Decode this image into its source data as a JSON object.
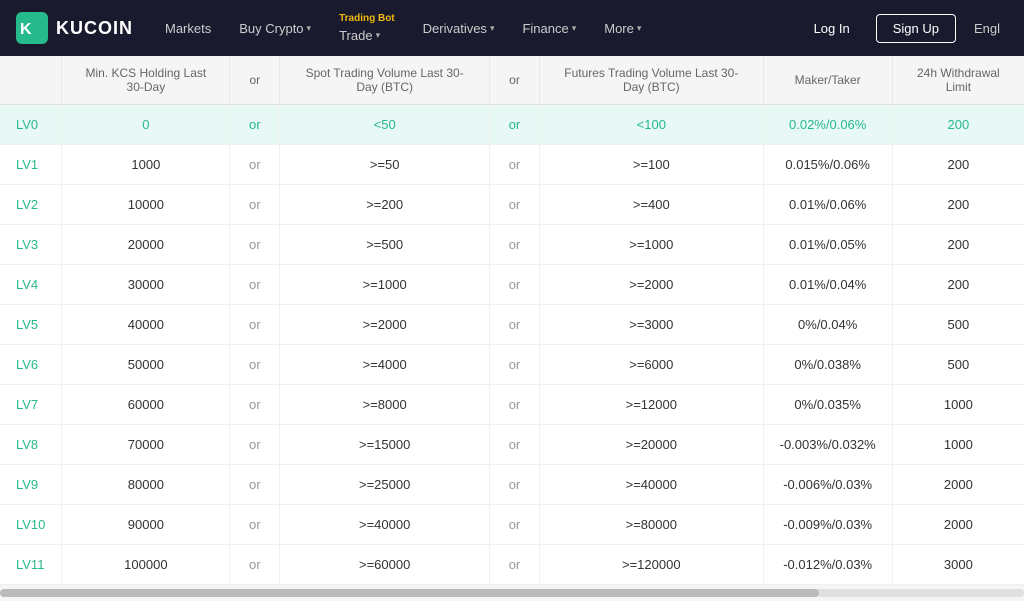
{
  "navbar": {
    "logo_text": "KUCOIN",
    "markets_label": "Markets",
    "buy_crypto_label": "Buy Crypto",
    "trading_bot_sublabel": "Trading Bot",
    "trade_label": "Trade",
    "derivatives_label": "Derivatives",
    "finance_label": "Finance",
    "more_label": "More",
    "login_label": "Log In",
    "signup_label": "Sign Up",
    "lang_label": "Engl"
  },
  "table": {
    "headers": [
      "Min. KCS Holding Last 30-Day",
      "or",
      "Spot Trading Volume Last 30-Day (BTC)",
      "or",
      "Futures Trading Volume Last 30-Day (BTC)",
      "Maker/Taker",
      "24h Withdrawal Limit"
    ],
    "rows": [
      {
        "level": "LV0",
        "kcs": "0",
        "or1": "or",
        "spot": "<50",
        "or2": "or",
        "futures": "<100",
        "fee": "0.02%/0.06%",
        "limit": "200",
        "highlight": true
      },
      {
        "level": "LV1",
        "kcs": "1000",
        "or1": "or",
        "spot": ">=50",
        "or2": "or",
        "futures": ">=100",
        "fee": "0.015%/0.06%",
        "limit": "200",
        "highlight": false
      },
      {
        "level": "LV2",
        "kcs": "10000",
        "or1": "or",
        "spot": ">=200",
        "or2": "or",
        "futures": ">=400",
        "fee": "0.01%/0.06%",
        "limit": "200",
        "highlight": false
      },
      {
        "level": "LV3",
        "kcs": "20000",
        "or1": "or",
        "spot": ">=500",
        "or2": "or",
        "futures": ">=1000",
        "fee": "0.01%/0.05%",
        "limit": "200",
        "highlight": false
      },
      {
        "level": "LV4",
        "kcs": "30000",
        "or1": "or",
        "spot": ">=1000",
        "or2": "or",
        "futures": ">=2000",
        "fee": "0.01%/0.04%",
        "limit": "200",
        "highlight": false
      },
      {
        "level": "LV5",
        "kcs": "40000",
        "or1": "or",
        "spot": ">=2000",
        "or2": "or",
        "futures": ">=3000",
        "fee": "0%/0.04%",
        "limit": "500",
        "highlight": false
      },
      {
        "level": "LV6",
        "kcs": "50000",
        "or1": "or",
        "spot": ">=4000",
        "or2": "or",
        "futures": ">=6000",
        "fee": "0%/0.038%",
        "limit": "500",
        "highlight": false
      },
      {
        "level": "LV7",
        "kcs": "60000",
        "or1": "or",
        "spot": ">=8000",
        "or2": "or",
        "futures": ">=12000",
        "fee": "0%/0.035%",
        "limit": "1000",
        "highlight": false
      },
      {
        "level": "LV8",
        "kcs": "70000",
        "or1": "or",
        "spot": ">=15000",
        "or2": "or",
        "futures": ">=20000",
        "fee": "-0.003%/0.032%",
        "limit": "1000",
        "highlight": false
      },
      {
        "level": "LV9",
        "kcs": "80000",
        "or1": "or",
        "spot": ">=25000",
        "or2": "or",
        "futures": ">=40000",
        "fee": "-0.006%/0.03%",
        "limit": "2000",
        "highlight": false
      },
      {
        "level": "LV10",
        "kcs": "90000",
        "or1": "or",
        "spot": ">=40000",
        "or2": "or",
        "futures": ">=80000",
        "fee": "-0.009%/0.03%",
        "limit": "2000",
        "highlight": false
      },
      {
        "level": "LV11",
        "kcs": "100000",
        "or1": "or",
        "spot": ">=60000",
        "or2": "or",
        "futures": ">=120000",
        "fee": "-0.012%/0.03%",
        "limit": "3000",
        "highlight": false
      }
    ]
  },
  "colors": {
    "navbar_bg": "#1a1a2e",
    "accent_green": "#26b98b",
    "highlight_row_bg": "#e8f9f5",
    "trading_bot_color": "#f0b90b"
  }
}
